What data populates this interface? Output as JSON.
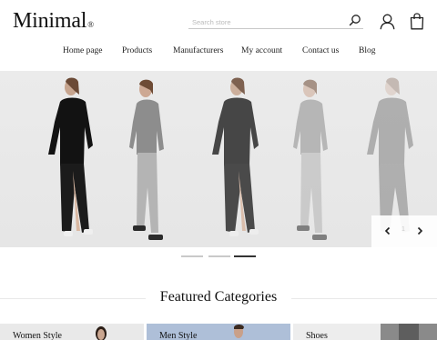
{
  "header": {
    "logo": "Minimal",
    "logo_mark": "®",
    "search_placeholder": "Search store"
  },
  "nav": {
    "items": [
      "Home page",
      "Products",
      "Manufacturers",
      "My account",
      "Contact us",
      "Blog"
    ]
  },
  "hero": {
    "slides_total": 3,
    "active_slide": 3,
    "counter": "1",
    "prev_icon": "chevron-left-icon",
    "next_icon": "chevron-right-icon"
  },
  "featured": {
    "title": "Featured Categories",
    "categories": [
      "Women Style",
      "Men Style",
      "Shoes"
    ]
  },
  "colors": {
    "text": "#222222",
    "hero_bg": "#e8e8e8",
    "dot_active": "#333333",
    "dot_inactive": "#c9c9c9"
  }
}
